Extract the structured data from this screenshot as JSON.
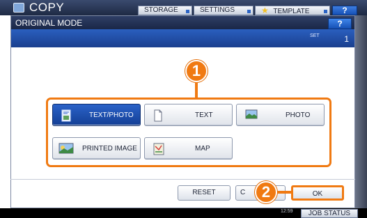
{
  "app": {
    "title": "COPY"
  },
  "top_tabs": {
    "storage": "STORAGE",
    "settings": "SETTINGS",
    "template": "TEMPLATE",
    "help": "?"
  },
  "dialog": {
    "title": "ORIGINAL MODE",
    "help": "?",
    "set_label": "SET",
    "set_count": "1"
  },
  "modes": {
    "text_photo": "TEXT/PHOTO",
    "text": "TEXT",
    "photo": "PHOTO",
    "printed_image": "PRINTED IMAGE",
    "map": "MAP"
  },
  "selected_mode": "TEXT/PHOTO",
  "callouts": {
    "one": "1",
    "two": "2"
  },
  "buttons": {
    "reset": "RESET",
    "cancel": "C",
    "ok": "OK"
  },
  "footer": {
    "clock": "12:59",
    "job_status": "JOB STATUS"
  },
  "colors": {
    "accent_orange": "#f07a12",
    "selected_blue": "#1f4fae",
    "header_navy": "#1e2a44"
  },
  "icons": {
    "app": "copier-icon",
    "text_photo": "text-photo-icon",
    "text": "document-icon",
    "photo": "photo-icon",
    "printed_image": "printed-image-icon",
    "map": "map-icon",
    "template": "star-icon"
  }
}
